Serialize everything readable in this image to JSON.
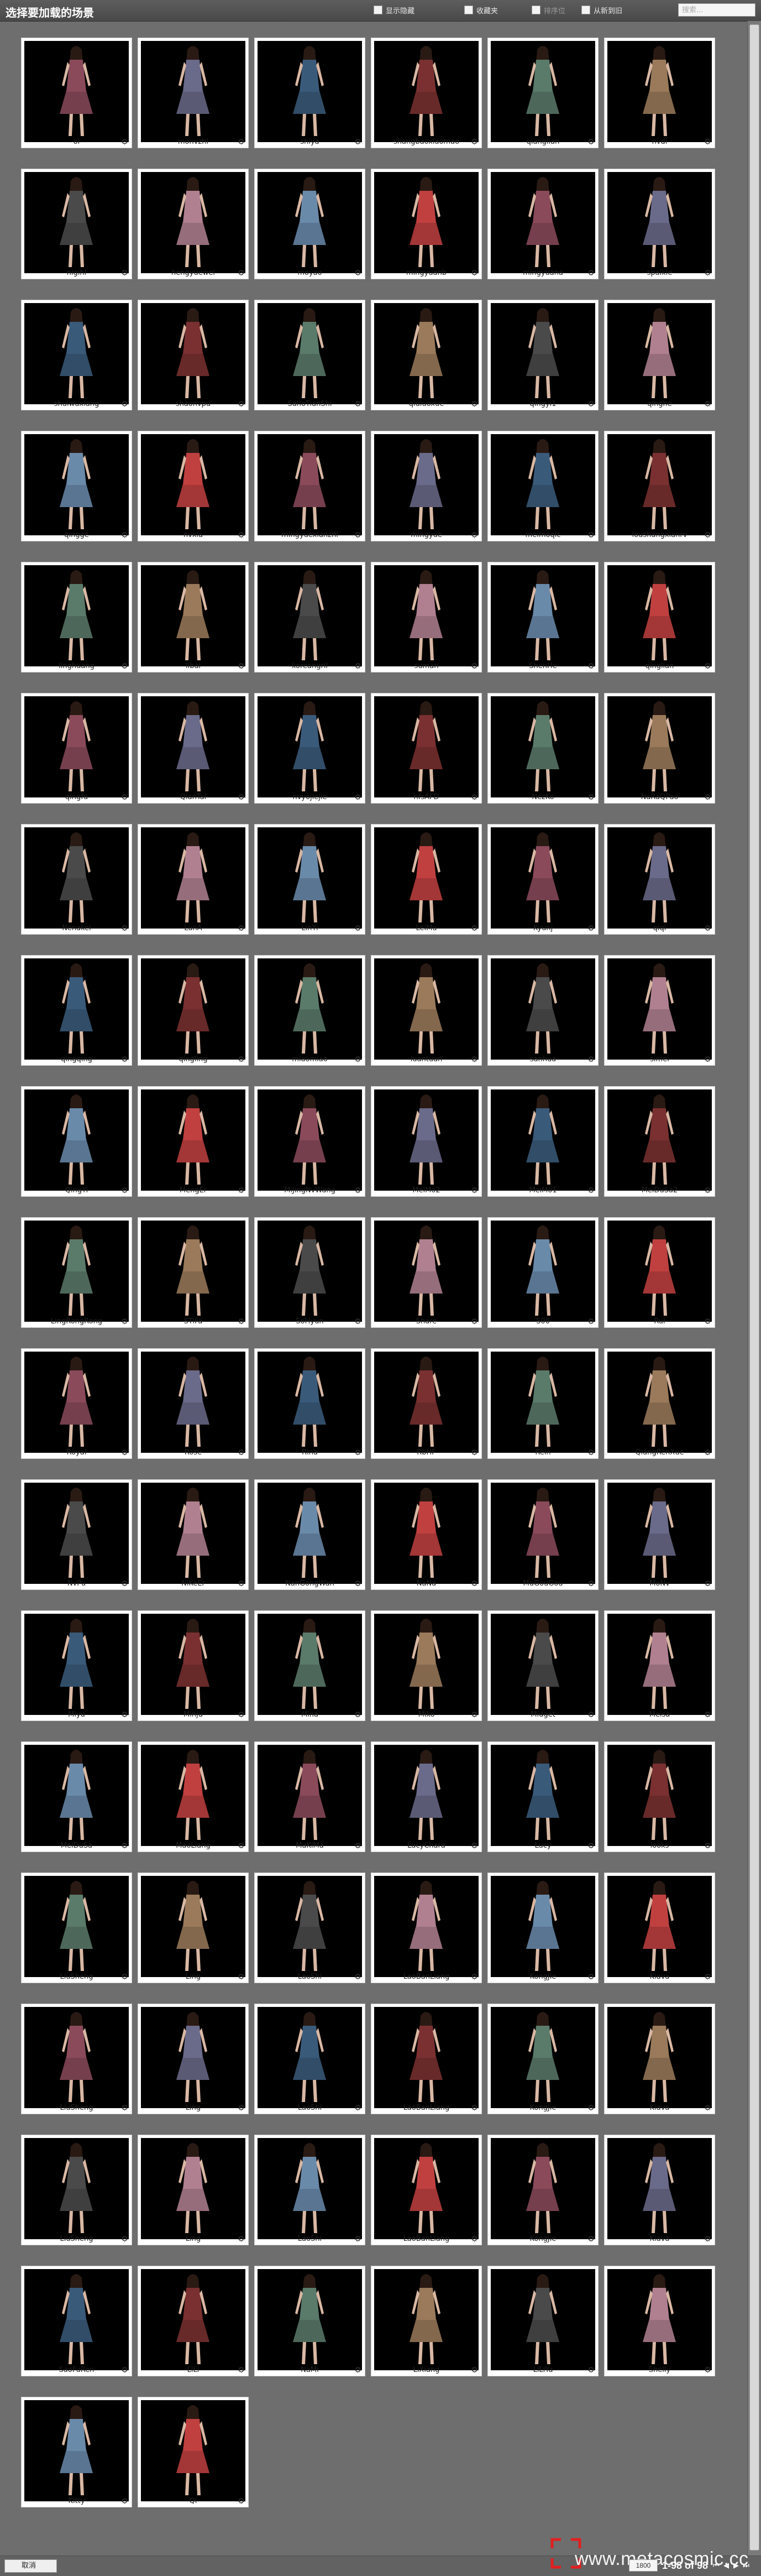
{
  "window": {
    "title": "选择要加载的场景"
  },
  "toolbar": {
    "show_hidden_label": "显示隐藏",
    "favorites_label": "收藏夹",
    "sort_label": "排序位",
    "from_new_to_old_label": "从新到旧",
    "search_placeholder": "搜索..."
  },
  "items": [
    {
      "name": "ol"
    },
    {
      "name": "monvzhi"
    },
    {
      "name": "shiya"
    },
    {
      "name": "shangbaoxiaomao"
    },
    {
      "name": "qianglian"
    },
    {
      "name": "nvdi"
    },
    {
      "name": "nigihl"
    },
    {
      "name": "hengyuewei"
    },
    {
      "name": "moyao"
    },
    {
      "name": "mingyuanb"
    },
    {
      "name": "mingyuana"
    },
    {
      "name": "spalkle"
    },
    {
      "name": "shuiwuxiang"
    },
    {
      "name": "shaonvpu"
    },
    {
      "name": "SahoTianShi"
    },
    {
      "name": "qiuluoxue"
    },
    {
      "name": "qingyi1"
    },
    {
      "name": "qinghe"
    },
    {
      "name": "qingge"
    },
    {
      "name": "nvxia"
    },
    {
      "name": "mingyuexianzhi"
    },
    {
      "name": "mingyue"
    },
    {
      "name": "meimoqic"
    },
    {
      "name": "loushangxianrv"
    },
    {
      "name": "linghuang"
    },
    {
      "name": "libai"
    },
    {
      "name": "koreangril"
    },
    {
      "name": "suman"
    },
    {
      "name": "ShenHe"
    },
    {
      "name": "qinglian"
    },
    {
      "name": "qingfu"
    },
    {
      "name": "QianTai"
    },
    {
      "name": "nvyojiejie"
    },
    {
      "name": "nfsAFD"
    },
    {
      "name": "NezKo"
    },
    {
      "name": "NaRaQPao"
    },
    {
      "name": "Nenakei"
    },
    {
      "name": "LunA"
    },
    {
      "name": "LinYi"
    },
    {
      "name": "LeiMu"
    },
    {
      "name": "Kyunj"
    },
    {
      "name": "qiqi"
    },
    {
      "name": "qingqing"
    },
    {
      "name": "qingling"
    },
    {
      "name": "miaomiao"
    },
    {
      "name": "luantuan"
    },
    {
      "name": "sanhua"
    },
    {
      "name": "simei"
    },
    {
      "name": "QingYi"
    },
    {
      "name": "MengEr"
    },
    {
      "name": "MiJingNvWang"
    },
    {
      "name": "MeiMo2"
    },
    {
      "name": "MeiMo1"
    },
    {
      "name": "MeiDuSa2"
    },
    {
      "name": "LingRongRong"
    },
    {
      "name": "STiFa"
    },
    {
      "name": "SoHyun"
    },
    {
      "name": "Share"
    },
    {
      "name": "S00"
    },
    {
      "name": "Rui"
    },
    {
      "name": "Royal"
    },
    {
      "name": "Rose"
    },
    {
      "name": "Rina"
    },
    {
      "name": "RbHF"
    },
    {
      "name": "Rein"
    },
    {
      "name": "QiangRenXue"
    },
    {
      "name": "NvPu"
    },
    {
      "name": "NiKeEr"
    },
    {
      "name": "NanGongWan"
    },
    {
      "name": "NaNa"
    },
    {
      "name": "MuGouGou"
    },
    {
      "name": "MoNv"
    },
    {
      "name": "Miyu"
    },
    {
      "name": "Minju"
    },
    {
      "name": "Mina"
    },
    {
      "name": "Miko"
    },
    {
      "name": "Midget"
    },
    {
      "name": "Meisa"
    },
    {
      "name": "MeiDuSa"
    },
    {
      "name": "MaoLiang"
    },
    {
      "name": "MaKiMa"
    },
    {
      "name": "LucyChara"
    },
    {
      "name": "Lucy"
    },
    {
      "name": "looks"
    },
    {
      "name": "LiuSheng"
    },
    {
      "name": "Ling"
    },
    {
      "name": "LaoShi"
    },
    {
      "name": "LaoBanLiang"
    },
    {
      "name": "KongJie"
    },
    {
      "name": "Kiava"
    },
    {
      "name": "LiuSheng"
    },
    {
      "name": "Ling"
    },
    {
      "name": "LaoShi"
    },
    {
      "name": "LaoBanLiang"
    },
    {
      "name": "KongJie"
    },
    {
      "name": "Kiava"
    },
    {
      "name": "LiuSheng"
    },
    {
      "name": "Ling"
    },
    {
      "name": "LaoShi"
    },
    {
      "name": "LaoBanLiang"
    },
    {
      "name": "KongJie"
    },
    {
      "name": "Kiava"
    },
    {
      "name": "SaoFuRen"
    },
    {
      "name": "LiLi"
    },
    {
      "name": "NaMi"
    },
    {
      "name": "LiXiang"
    },
    {
      "name": "LiLiYa"
    },
    {
      "name": "Shelly"
    },
    {
      "name": "Kitty"
    },
    {
      "name": "Qi"
    }
  ],
  "footer": {
    "cancel_label": "取消",
    "page_size": "1800",
    "page_info": "1-98 of 98",
    "watermark": "www.metacosmic.cc"
  }
}
